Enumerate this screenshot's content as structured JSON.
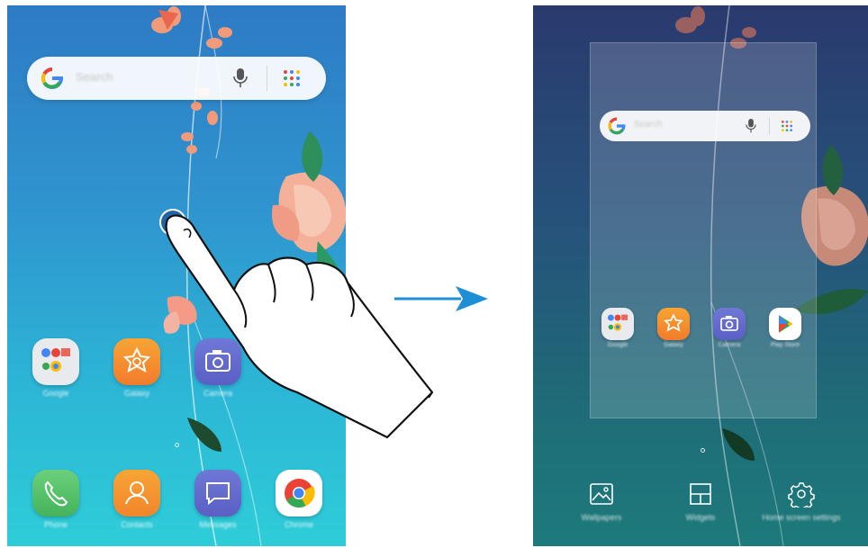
{
  "left_screen": {
    "search": {
      "placeholder": "Search"
    },
    "apps": [
      {
        "icon": "google-folder-icon",
        "label": "Google"
      },
      {
        "icon": "galaxy-apps-icon",
        "label": "Galaxy"
      },
      {
        "icon": "camera-icon",
        "label": "Camera"
      }
    ],
    "dock": [
      {
        "icon": "phone-icon",
        "label": "Phone"
      },
      {
        "icon": "contacts-icon",
        "label": "Contacts"
      },
      {
        "icon": "messages-icon",
        "label": "Messages"
      },
      {
        "icon": "chrome-icon",
        "label": "Chrome"
      }
    ]
  },
  "right_screen": {
    "search": {
      "placeholder": "Search"
    },
    "apps": [
      {
        "icon": "google-folder-icon",
        "label": "Google"
      },
      {
        "icon": "galaxy-apps-icon",
        "label": "Galaxy"
      },
      {
        "icon": "camera-icon",
        "label": "Camera"
      },
      {
        "icon": "play-store-icon",
        "label": "Play Store"
      }
    ],
    "options": [
      {
        "icon": "wallpapers-icon",
        "label": "Wallpapers"
      },
      {
        "icon": "widgets-icon",
        "label": "Widgets"
      },
      {
        "icon": "gear-icon",
        "label": "Home screen settings"
      }
    ]
  },
  "colors": {
    "arrow": "#1e8fd6",
    "google_blue": "#4285F4",
    "google_red": "#EA4335",
    "google_yellow": "#FBBC05",
    "google_green": "#34A853"
  }
}
